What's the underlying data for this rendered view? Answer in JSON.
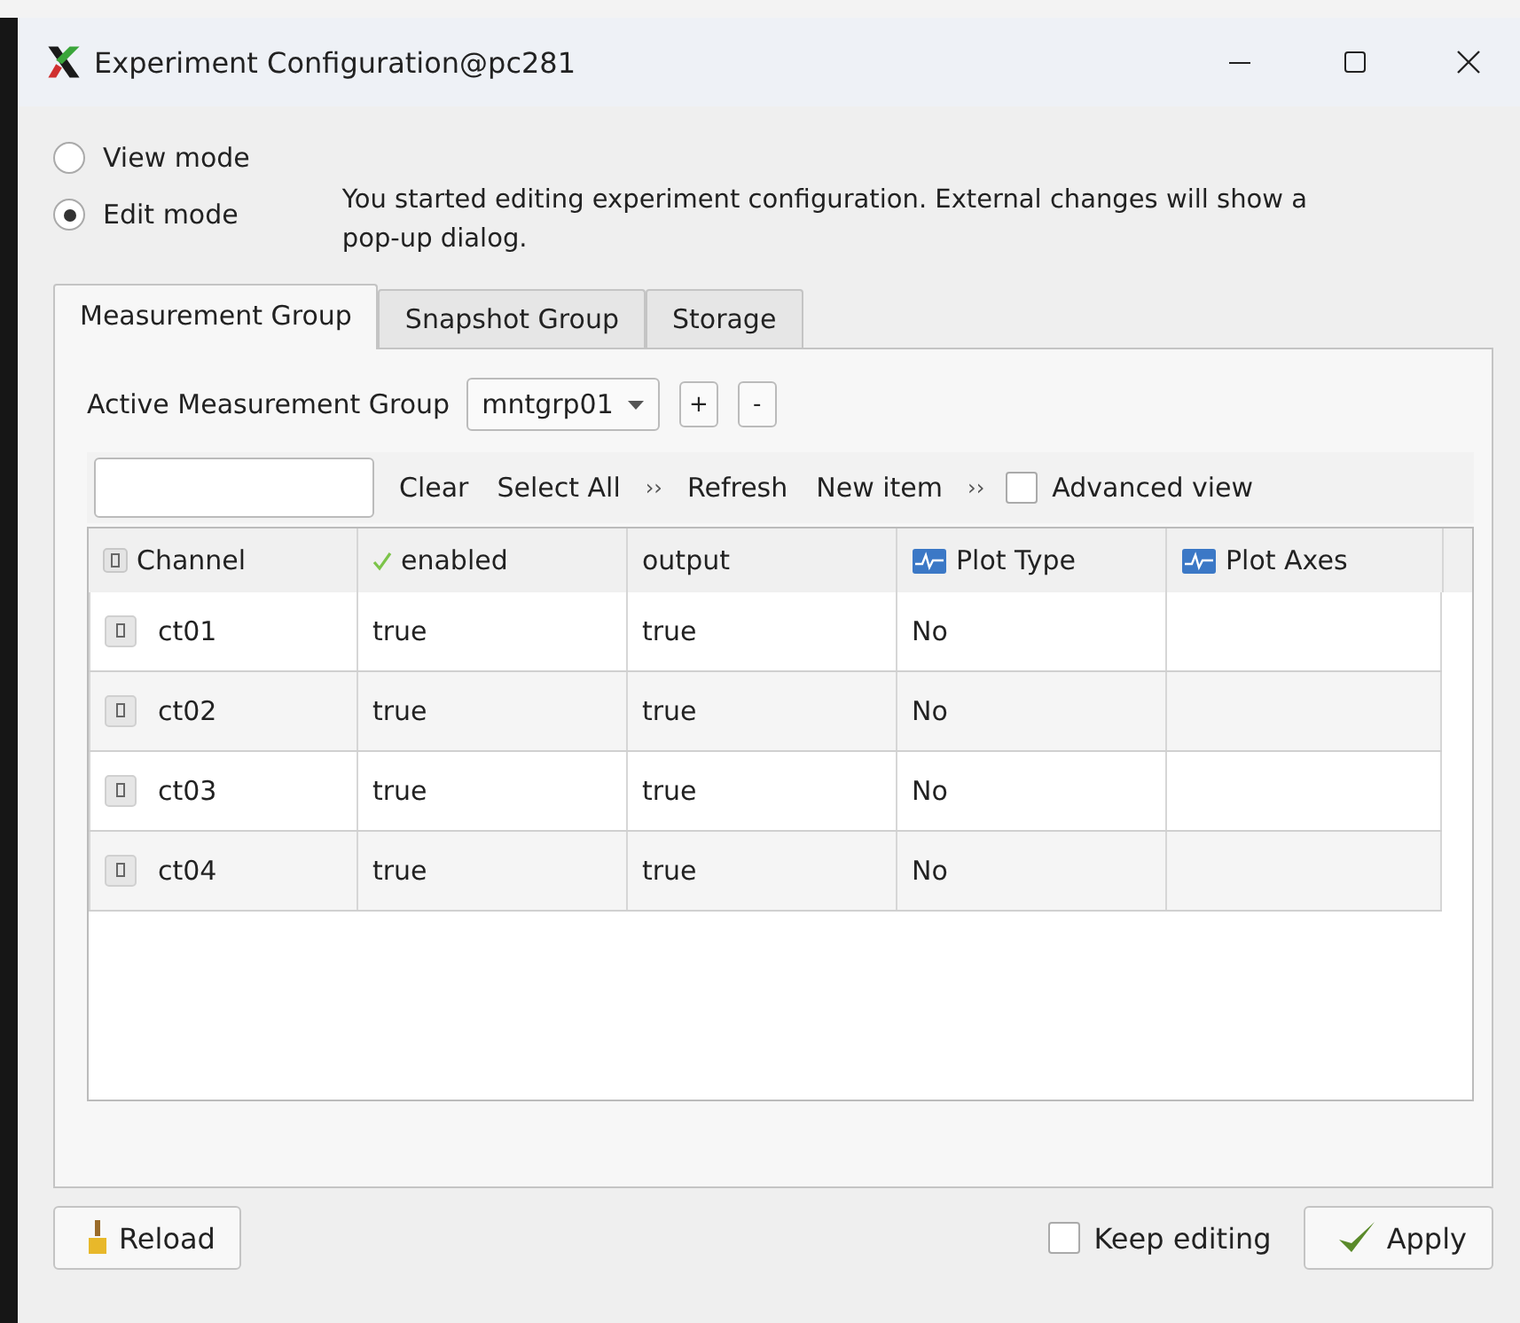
{
  "window": {
    "title": "Experiment Configuration@pc281"
  },
  "modes": [
    {
      "label": "View mode",
      "selected": false
    },
    {
      "label": "Edit mode",
      "selected": true
    }
  ],
  "notice": "You started editing experiment configuration. External changes will show a pop-up dialog.",
  "tabs": [
    {
      "label": "Measurement Group",
      "selected": true
    },
    {
      "label": "Snapshot Group",
      "selected": false
    },
    {
      "label": "Storage",
      "selected": false
    }
  ],
  "active_group": {
    "label": "Active Measurement Group",
    "value": "mntgrp01",
    "buttons": [
      "+",
      "-"
    ]
  },
  "toolbar": {
    "items": [
      {
        "kind": "button",
        "label": "Clear"
      },
      {
        "kind": "button",
        "label": "Select All"
      },
      {
        "kind": "more",
        "label": "››"
      },
      {
        "kind": "button",
        "label": "Refresh"
      },
      {
        "kind": "button",
        "label": "New item"
      },
      {
        "kind": "more",
        "label": "››"
      },
      {
        "kind": "checkbox",
        "label": "Advanced view",
        "checked": false
      }
    ]
  },
  "table": {
    "columns": [
      {
        "label": "Channel",
        "kind": "channel"
      },
      {
        "label": "enabled",
        "kind": "check"
      },
      {
        "label": "output",
        "kind": "plain"
      },
      {
        "label": "Plot Type",
        "kind": "plot"
      },
      {
        "label": "Plot Axes",
        "kind": "plot"
      }
    ],
    "rows": [
      {
        "channel": "ct01",
        "enabled": "true",
        "output": "true",
        "plot_type": "No"
      },
      {
        "channel": "ct02",
        "enabled": "true",
        "output": "true",
        "plot_type": "No"
      },
      {
        "channel": "ct03",
        "enabled": "true",
        "output": "true",
        "plot_type": "No"
      },
      {
        "channel": "ct04",
        "enabled": "true",
        "output": "true",
        "plot_type": "No"
      }
    ]
  },
  "footer": {
    "reload": "Reload",
    "keep_editing": {
      "label": "Keep editing",
      "checked": false
    },
    "apply": "Apply"
  }
}
